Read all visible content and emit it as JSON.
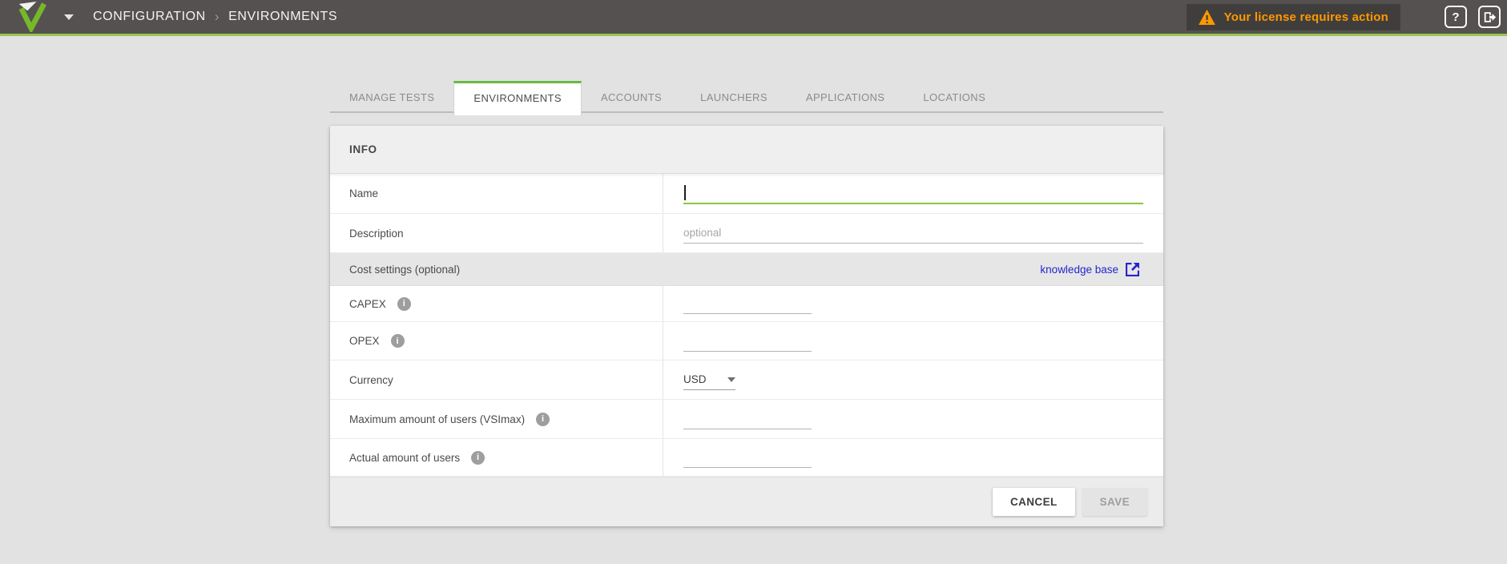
{
  "header": {
    "breadcrumb": {
      "items": [
        "CONFIGURATION",
        "ENVIRONMENTS"
      ],
      "separator": "›"
    },
    "license_warning": "Your license requires action"
  },
  "icons": {
    "help": "?",
    "info": "i",
    "logo": "login-vsi-v-logo",
    "logout": "logout-door-arrow",
    "warning": "warning-triangle",
    "external_link": "open-in-new"
  },
  "tabs": {
    "items": [
      "MANAGE TESTS",
      "ENVIRONMENTS",
      "ACCOUNTS",
      "LAUNCHERS",
      "APPLICATIONS",
      "LOCATIONS"
    ],
    "active": "ENVIRONMENTS"
  },
  "panel": {
    "title": "INFO",
    "fields": {
      "name": {
        "label": "Name",
        "value": ""
      },
      "description": {
        "label": "Description",
        "value": "",
        "placeholder": "optional"
      },
      "capex": {
        "label": "CAPEX",
        "value": ""
      },
      "opex": {
        "label": "OPEX",
        "value": ""
      },
      "currency": {
        "label": "Currency",
        "value": "USD"
      },
      "vsimax": {
        "label": "Maximum amount of users (VSImax)",
        "value": ""
      },
      "actual_users": {
        "label": "Actual amount of users",
        "value": ""
      }
    },
    "cost_section": {
      "label": "Cost settings (optional)",
      "link_label": "knowledge base"
    },
    "footer": {
      "cancel": "CANCEL",
      "save": "SAVE"
    }
  },
  "colors": {
    "topbar_bg": "#555150",
    "accent_green": "#76b82a",
    "tab_indicator_green": "#66bb3e",
    "focus_underline_green": "#8dc63f",
    "warning_orange": "#ff9800",
    "link_blue": "#2525d0"
  }
}
